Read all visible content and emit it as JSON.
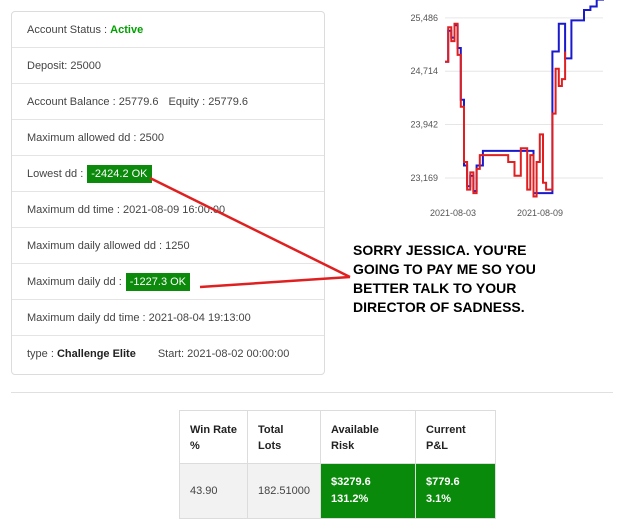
{
  "account": {
    "status_label": "Account Status :",
    "status_value": "Active",
    "deposit": "Deposit: 25000",
    "balance": "Account Balance : 25779.6",
    "equity": "Equity : 25779.6",
    "max_dd": "Maximum allowed dd : 2500",
    "lowest_dd_label": "Lowest dd :",
    "lowest_dd_value": "-2424.2 OK",
    "max_dd_time": "Maximum dd time : 2021-08-09 16:00:00",
    "max_daily_allowed": "Maximum daily allowed dd : 1250",
    "max_daily_dd_label": "Maximum daily dd :",
    "max_daily_dd_value": "-1227.3 OK",
    "max_daily_dd_time": "Maximum daily dd time : 2021-08-04 19:13:00",
    "type_label": "type :",
    "type_value": "Challenge Elite",
    "start": "Start: 2021-08-02 00:00:00"
  },
  "annotation": {
    "lines": [
      "SORRY JESSICA. YOU'RE",
      "GOING TO PAY ME SO YOU",
      "BETTER TALK TO YOUR",
      "DIRECTOR OF SADNESS."
    ],
    "arrow_color": "#e02020"
  },
  "stats": {
    "headers": [
      {
        "line1": "Win Rate",
        "line2": "%"
      },
      {
        "line1": "Total",
        "line2": "Lots"
      },
      {
        "line1": "",
        "line2": "Available Risk"
      },
      {
        "line1": "Current",
        "line2": "P&L"
      }
    ],
    "win_rate": "43.90",
    "total_lots": "182.51000",
    "available_risk": {
      "line1": "$3279.6",
      "line2": "131.2%"
    },
    "current_pnl": {
      "line1": "$779.6",
      "line2": "3.1%"
    }
  },
  "colors": {
    "active": "#00a000",
    "badge_green": "#0c8a0c",
    "cell_green": "#0a8a0a",
    "series_balance": "#1a1acd",
    "series_equity": "#e02020"
  },
  "chart_data": {
    "type": "line",
    "title": "",
    "xlabel": "",
    "ylabel": "",
    "yticks": [
      "25,486",
      "24,714",
      "23,942",
      "23,169"
    ],
    "xticks": [
      "2021-08-03",
      "2021-08-09"
    ],
    "ylim": [
      22850,
      25600
    ],
    "grid": true,
    "series": [
      {
        "color": "#1a1acd",
        "x": [
          0,
          2,
          4,
          6,
          8,
          10,
          12,
          14,
          16,
          18,
          20,
          24,
          30,
          34,
          40,
          44,
          48,
          52,
          56,
          60,
          64,
          68,
          72,
          76,
          80,
          84,
          88,
          92,
          96,
          100
        ],
        "y": [
          24850,
          25300,
          25200,
          25380,
          25050,
          24300,
          23350,
          23050,
          23200,
          22980,
          23350,
          23560,
          23560,
          23560,
          23560,
          23560,
          23560,
          23560,
          22950,
          22950,
          22950,
          25000,
          25400,
          24900,
          25450,
          25450,
          25600,
          25650,
          25750,
          25780
        ]
      },
      {
        "color": "#e02020",
        "x": [
          0,
          2,
          4,
          6,
          8,
          10,
          12,
          14,
          16,
          18,
          20,
          22,
          40,
          44,
          48,
          52,
          54,
          56,
          58,
          60,
          62,
          64,
          68,
          70,
          72,
          74,
          76
        ],
        "y": [
          24850,
          25350,
          25150,
          25400,
          24950,
          24200,
          23400,
          23000,
          23250,
          22950,
          23300,
          23500,
          23400,
          23200,
          23600,
          23000,
          23500,
          22900,
          23400,
          23800,
          23100,
          23000,
          24100,
          24750,
          24500,
          24600,
          25000
        ]
      }
    ]
  }
}
